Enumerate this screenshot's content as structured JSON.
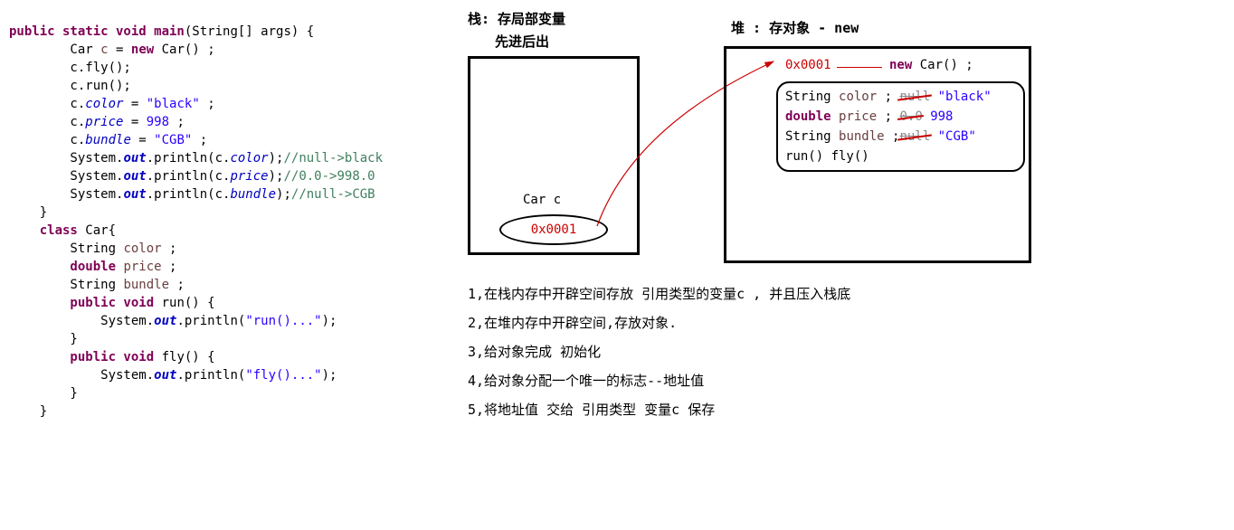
{
  "code": {
    "sig": "public static void main",
    "sig_args": "(String[] args) {",
    "l1_a": "        Car ",
    "l1_b": "c",
    "l1_c": " = ",
    "l1_d": "new",
    "l1_e": " Car() ;",
    "l2": "        c.fly();",
    "l3": "        c.run();",
    "l4_a": "        c.",
    "l4_b": "color",
    "l4_c": " = ",
    "l4_d": "\"black\"",
    "l4_e": " ;",
    "l5_a": "        c.",
    "l5_b": "price",
    "l5_c": " = ",
    "l5_d": "998",
    "l5_e": " ;",
    "l6_a": "        c.",
    "l6_b": "bundle",
    "l6_c": " = ",
    "l6_d": "\"CGB\"",
    "l6_e": " ;",
    "l7_a": "        System.",
    "l7_b": "out",
    "l7_c": ".println(c.",
    "l7_d": "color",
    "l7_e": ");",
    "l7_f": "//null->black",
    "l8_a": "        System.",
    "l8_b": "out",
    "l8_c": ".println(c.",
    "l8_d": "price",
    "l8_e": ");",
    "l8_f": "//0.0->998.0",
    "l9_a": "        System.",
    "l9_b": "out",
    "l9_c": ".println(c.",
    "l9_d": "bundle",
    "l9_e": ");",
    "l9_f": "//null->CGB",
    "l10": "    }",
    "l11_a": "    class",
    "l11_b": " Car{",
    "l12_a": "        String ",
    "l12_b": "color",
    "l12_c": " ;",
    "l13_a": "        double ",
    "l13_b": "price",
    "l13_c": " ;",
    "l14_a": "        String ",
    "l14_b": "bundle",
    "l14_c": " ;",
    "l15_a": "        public void",
    "l15_b": " run() {",
    "l16_a": "            System.",
    "l16_b": "out",
    "l16_c": ".println(",
    "l16_d": "\"run()...\"",
    "l16_e": ");",
    "l17": "        }",
    "l18_a": "        public void",
    "l18_b": " fly() {",
    "l19_a": "            System.",
    "l19_b": "out",
    "l19_c": ".println(",
    "l19_d": "\"fly()...\"",
    "l19_e": ");",
    "l20": "        }",
    "l21": "    }"
  },
  "stack": {
    "title": "栈: 存局部变量",
    "sub": "先进后出",
    "var_label": "Car c",
    "addr": "0x0001"
  },
  "heap": {
    "title": "堆 : 存对象 - new",
    "addr": "0x0001",
    "new_expr_kw": "new",
    "new_expr_rest": " Car() ;",
    "obj": {
      "r1_a": "String ",
      "r1_field": "color",
      "r1_b": " ; ",
      "r1_old": "null",
      "r1_new": "\"black\"",
      "r2_a": "double ",
      "r2_field": "price",
      "r2_b": " ; ",
      "r2_old": "0.0",
      "r2_new": "998",
      "r3_a": "String ",
      "r3_field": "bundle",
      "r3_b": " ;",
      "r3_old": "null",
      "r3_new": "\"CGB\"",
      "r4": "run()   fly()"
    }
  },
  "steps": {
    "s1": "1,在栈内存中开辟空间存放 引用类型的变量c , 并且压入栈底",
    "s2": "2,在堆内存中开辟空间,存放对象.",
    "s3": "3,给对象完成  初始化",
    "s4": "4,给对象分配一个唯一的标志--地址值",
    "s5": "5,将地址值  交给 引用类型 变量c 保存"
  }
}
